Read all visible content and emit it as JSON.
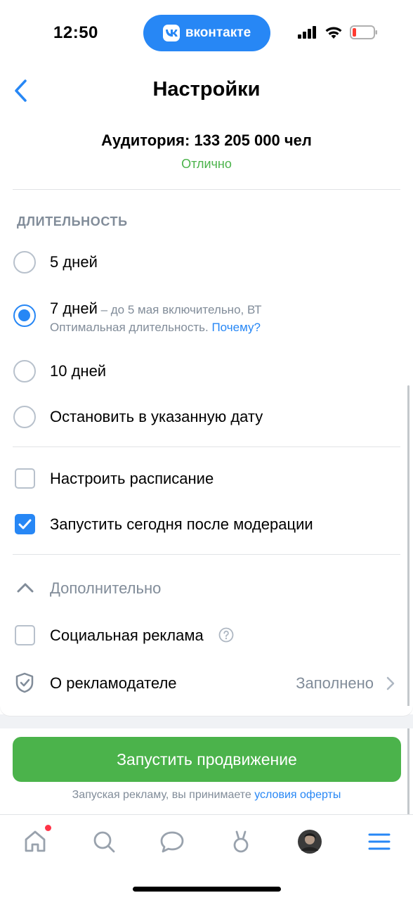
{
  "status_bar": {
    "time": "12:50",
    "app_pill": "вконтакте"
  },
  "header": {
    "title": "Настройки"
  },
  "audience": {
    "text": "Аудитория: 133 205 000 чел",
    "status": "Отлично"
  },
  "duration": {
    "section_title": "ДЛИТЕЛЬНОСТЬ",
    "options": [
      {
        "label": "5 дней",
        "selected": false
      },
      {
        "label": "7 дней",
        "suffix": " – до 5 мая включительно, ВТ",
        "hint": "Оптимальная длительность.",
        "hint_link": "Почему?",
        "selected": true
      },
      {
        "label": "10 дней",
        "selected": false
      },
      {
        "label": "Остановить в указанную дату",
        "selected": false
      }
    ]
  },
  "schedule": {
    "custom_schedule": {
      "label": "Настроить расписание",
      "checked": false
    },
    "start_today": {
      "label": "Запустить сегодня после модерации",
      "checked": true
    }
  },
  "extra": {
    "title": "Дополнительно",
    "social_ad": {
      "label": "Социальная реклама",
      "checked": false
    },
    "advertiser": {
      "label": "О рекламодателе",
      "value": "Заполнено"
    }
  },
  "footer": {
    "launch_button": "Запустить продвижение",
    "terms_text": "Запуская рекламу, вы принимаете",
    "terms_link": "условия оферты"
  },
  "colors": {
    "accent": "#2787f5",
    "green": "#4bb34b",
    "gray": "#818c99"
  }
}
